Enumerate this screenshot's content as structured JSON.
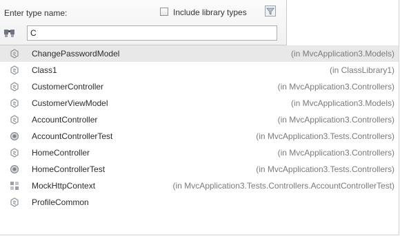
{
  "header": {
    "prompt": "Enter type name:",
    "include_library_label": "Include library types",
    "include_library_checked": false,
    "filter_icon": "filter-icon",
    "search_icon": "binoculars-icon"
  },
  "search": {
    "value": "C"
  },
  "colors": {
    "selection": "#e8e8e8",
    "namespace_text": "#7a7a7a",
    "icon_gray": "#8a8f94"
  },
  "results": [
    {
      "name": "ChangePasswordModel",
      "ns": "(in MvcApplication3.Models)",
      "icon": "class-icon",
      "selected": true
    },
    {
      "name": "Class1",
      "ns": "(in ClassLibrary1)",
      "icon": "class-icon"
    },
    {
      "name": "CustomerController",
      "ns": "(in MvcApplication3.Controllers)",
      "icon": "class-icon"
    },
    {
      "name": "CustomerViewModel",
      "ns": "(in MvcApplication3.Models)",
      "icon": "class-icon"
    },
    {
      "name": "AccountController",
      "ns": "(in MvcApplication3.Controllers)",
      "icon": "class-icon"
    },
    {
      "name": "AccountControllerTest",
      "ns": "(in MvcApplication3.Tests.Controllers)",
      "icon": "test-class-icon"
    },
    {
      "name": "HomeController",
      "ns": "(in MvcApplication3.Controllers)",
      "icon": "class-icon"
    },
    {
      "name": "HomeControllerTest",
      "ns": "(in MvcApplication3.Tests.Controllers)",
      "icon": "test-class-icon"
    },
    {
      "name": "MockHttpContext",
      "ns": "(in MvcApplication3.Tests.Controllers.AccountControllerTest)",
      "icon": "nested-class-icon"
    },
    {
      "name": "ProfileCommon",
      "ns": "",
      "icon": "class-icon"
    }
  ]
}
